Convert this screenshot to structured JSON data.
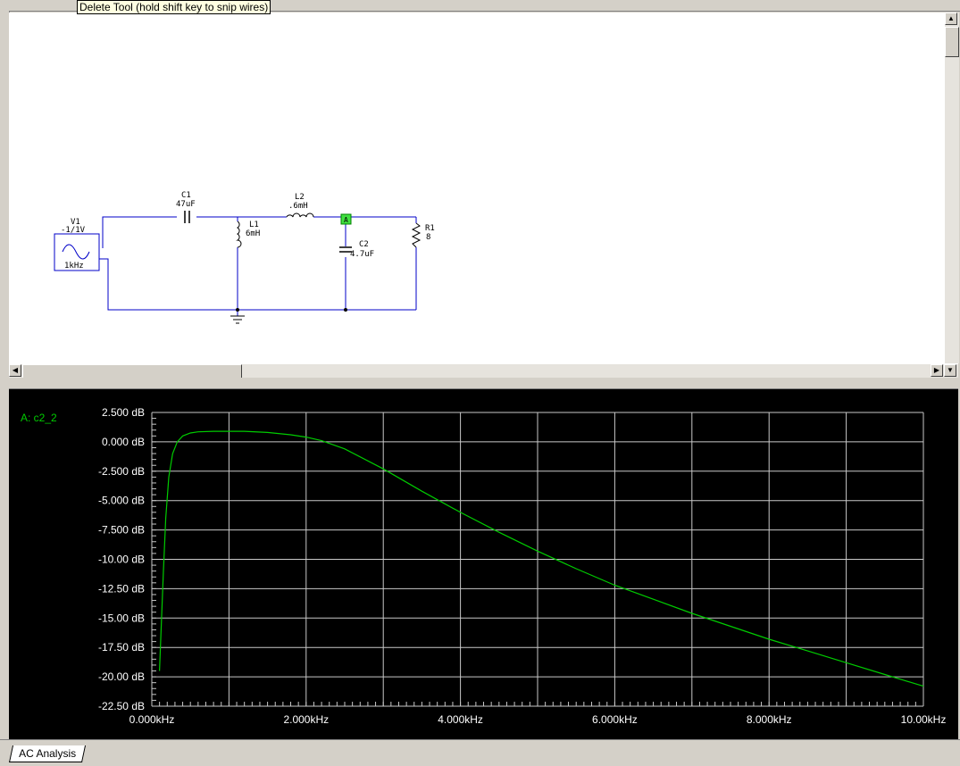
{
  "tooltip": "Delete Tool (hold shift key to snip wires)",
  "schematic": {
    "components": [
      {
        "name": "V1",
        "value": "-1/1V",
        "extra": "1kHz",
        "type": "ac-source"
      },
      {
        "name": "C1",
        "value": "47uF",
        "type": "capacitor"
      },
      {
        "name": "L1",
        "value": "6mH",
        "type": "inductor"
      },
      {
        "name": "L2",
        "value": ".6mH",
        "type": "inductor"
      },
      {
        "name": "C2",
        "value": "4.7uF",
        "type": "capacitor"
      },
      {
        "name": "R1",
        "value": "8",
        "type": "resistor"
      }
    ],
    "probe_label": "A"
  },
  "plot": {
    "trace_label": "A: c2_2",
    "background": "#000000",
    "trace_color": "#00cc00",
    "grid_color": "#c8c8c8",
    "text_color": "#ffffff"
  },
  "chart_data": {
    "type": "line",
    "title": "",
    "xlabel": "",
    "ylabel": "",
    "xlim": [
      0,
      10
    ],
    "ylim": [
      -22.5,
      2.5
    ],
    "x_unit": "kHz",
    "y_unit": "dB",
    "grid": true,
    "x_ticks": [
      "0.000kHz",
      "2.000kHz",
      "4.000kHz",
      "6.000kHz",
      "8.000kHz",
      "10.00kHz"
    ],
    "y_ticks": [
      "2.500 dB",
      "0.000 dB",
      "-2.500 dB",
      "-5.000 dB",
      "-7.500 dB",
      "-10.00 dB",
      "-12.50 dB",
      "-15.00 dB",
      "-17.50 dB",
      "-20.00 dB",
      "-22.50 dB"
    ],
    "series": [
      {
        "name": "c2_2",
        "x": [
          0.1,
          0.12,
          0.15,
          0.18,
          0.22,
          0.27,
          0.33,
          0.4,
          0.5,
          0.6,
          0.8,
          1.0,
          1.2,
          1.5,
          1.8,
          2.0,
          2.2,
          2.5,
          3.0,
          3.5,
          4.0,
          4.5,
          5.0,
          5.5,
          6.0,
          6.5,
          7.0,
          7.5,
          8.0,
          8.5,
          9.0,
          9.5,
          10.0
        ],
        "y": [
          -19.5,
          -16.0,
          -11.0,
          -6.5,
          -3.0,
          -1.0,
          0.0,
          0.5,
          0.75,
          0.85,
          0.9,
          0.9,
          0.9,
          0.8,
          0.6,
          0.4,
          0.1,
          -0.6,
          -2.3,
          -4.2,
          -6.0,
          -7.7,
          -9.3,
          -10.8,
          -12.2,
          -13.4,
          -14.6,
          -15.7,
          -16.8,
          -17.8,
          -18.8,
          -19.8,
          -20.8
        ]
      }
    ]
  }
}
